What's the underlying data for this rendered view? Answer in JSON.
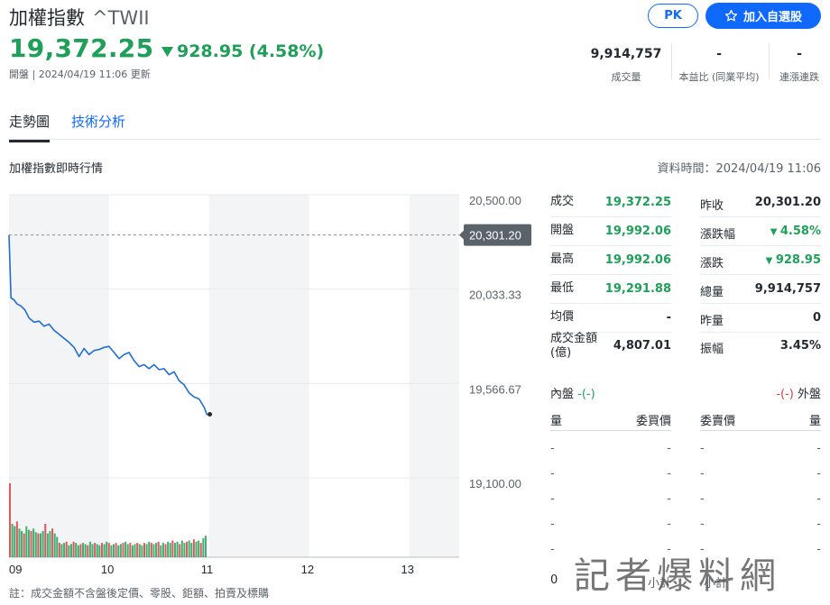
{
  "header": {
    "name": "加權指數",
    "symbol": "^TWII",
    "pk_label": "PK",
    "watch_label": "加入自選股",
    "price": "19,372.25",
    "change": "928.95 (4.58%)",
    "status": "開盤 | 2024/04/19 11:06 更新",
    "stats": [
      {
        "value": "9,914,757",
        "label": "成交量"
      },
      {
        "value": "-",
        "label": "本益比 (同業平均)"
      },
      {
        "value": "-",
        "label": "連漲連跌"
      }
    ]
  },
  "tabs": [
    "走勢圖",
    "技術分析"
  ],
  "section": {
    "title": "加權指數即時行情",
    "data_time": "資料時間：2024/04/19 11:06"
  },
  "colors": {
    "up": "#e0393e",
    "down": "#1ea058",
    "line": "#1f6ed4",
    "accent": "#0f69ff"
  },
  "chart_data": {
    "type": "line",
    "y_ticks": [
      "20,500.00",
      "20,033.33",
      "19,566.67",
      "19,100.00"
    ],
    "y_tick_values": [
      20500,
      20033.33,
      19566.67,
      19100
    ],
    "ylim": [
      19100,
      20500
    ],
    "prev_close_label": "20,301.20",
    "prev_close": 20301.2,
    "x_ticks": [
      "09",
      "10",
      "11",
      "12",
      "13"
    ],
    "x_tick_times": [
      9,
      10,
      11,
      12,
      13
    ],
    "xlim": [
      9,
      13.5
    ],
    "series": [
      {
        "t": [
          9.0,
          9.02,
          9.05,
          9.08,
          9.12,
          9.16,
          9.2,
          9.25,
          9.3,
          9.35,
          9.4,
          9.45,
          9.5,
          9.55,
          9.6,
          9.65,
          9.7,
          9.75,
          9.8,
          9.85,
          9.9,
          9.95,
          10.0,
          10.05,
          10.1,
          10.15,
          10.2,
          10.25,
          10.3,
          10.35,
          10.4,
          10.45,
          10.5,
          10.55,
          10.6,
          10.65,
          10.7,
          10.75,
          10.8,
          10.85,
          10.9,
          10.95,
          10.98
        ],
        "values": [
          20301,
          19990,
          19980,
          19960,
          19950,
          19930,
          19890,
          19870,
          19875,
          19850,
          19860,
          19830,
          19810,
          19790,
          19770,
          19745,
          19700,
          19740,
          19710,
          19730,
          19735,
          19745,
          19750,
          19720,
          19690,
          19710,
          19720,
          19680,
          19650,
          19660,
          19640,
          19660,
          19635,
          19640,
          19610,
          19625,
          19580,
          19560,
          19520,
          19500,
          19490,
          19450,
          19410
        ]
      }
    ],
    "volume": [
      62,
      28,
      26,
      30,
      24,
      22,
      20,
      26,
      23,
      22,
      24,
      21,
      20,
      20,
      22,
      28,
      20,
      22,
      24,
      20,
      17,
      12,
      11,
      12,
      13,
      10,
      11,
      13,
      12,
      10,
      11,
      12,
      11,
      10,
      13,
      11,
      12,
      11,
      10,
      12,
      11,
      13,
      12,
      10,
      11,
      12,
      10,
      11,
      12,
      13,
      11,
      12,
      10,
      11,
      12,
      11,
      10,
      12,
      11,
      13,
      12,
      11,
      12,
      13,
      10,
      12,
      11,
      13,
      12,
      14,
      12,
      13,
      11,
      14,
      12,
      13,
      14,
      12,
      15,
      13,
      14,
      12,
      16,
      18
    ]
  },
  "quote": {
    "left": [
      {
        "label": "成交",
        "value": "19,372.25",
        "color": "down"
      },
      {
        "label": "開盤",
        "value": "19,992.06",
        "color": "down"
      },
      {
        "label": "最高",
        "value": "19,992.06",
        "color": "down"
      },
      {
        "label": "最低",
        "value": "19,291.88",
        "color": "down"
      },
      {
        "label": "均價",
        "value": "-",
        "color": "none"
      },
      {
        "label": "成交金額\n(億)",
        "value": "4,807.01",
        "color": "none"
      }
    ],
    "right": [
      {
        "label": "昨收",
        "value": "20,301.20",
        "color": "none",
        "arrow": false
      },
      {
        "label": "漲跌幅",
        "value": "4.58%",
        "color": "down",
        "arrow": true
      },
      {
        "label": "漲跌",
        "value": "928.95",
        "color": "down",
        "arrow": true
      },
      {
        "label": "總量",
        "value": "9,914,757",
        "color": "none",
        "arrow": false
      },
      {
        "label": "昨量",
        "value": "0",
        "color": "none",
        "arrow": false
      },
      {
        "label": "振幅",
        "value": "3.45%",
        "color": "none",
        "arrow": false
      }
    ]
  },
  "book": {
    "inner_label": "內盤",
    "inner_value": "-(-)",
    "outer_label": "外盤",
    "outer_value": "-(-)",
    "cols": [
      "量",
      "委買價",
      "委賣價",
      "量"
    ],
    "rows": [
      [
        "-",
        "-",
        "-",
        "-"
      ],
      [
        "-",
        "-",
        "-",
        "-"
      ],
      [
        "-",
        "-",
        "-",
        "-"
      ],
      [
        "-",
        "-",
        "-",
        "-"
      ],
      [
        "-",
        "-",
        "-",
        "-"
      ]
    ],
    "total_left": "0",
    "total_mid1": "小計",
    "total_mid2": "小計"
  },
  "watermark": "記者爆料網",
  "footnote": "註：成交金額不含盤後定價、零股、鉅額、拍賣及標購"
}
